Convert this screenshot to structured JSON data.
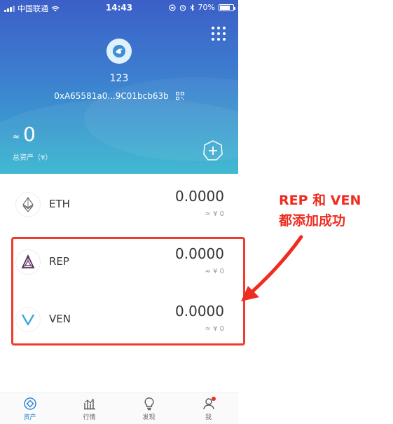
{
  "status_bar": {
    "carrier": "中国联通",
    "time": "14:43",
    "battery": "70%"
  },
  "header": {
    "wallet_name": "123",
    "address": "0xA65581a0...9C01bcb63b",
    "approx_symbol": "≈",
    "total_value": "0",
    "total_label": "总资产（¥）"
  },
  "assets": [
    {
      "symbol": "ETH",
      "balance": "0.0000",
      "fiat": "≈ ¥ 0",
      "icon": "eth-icon"
    },
    {
      "symbol": "REP",
      "balance": "0.0000",
      "fiat": "≈ ¥ 0",
      "icon": "rep-icon"
    },
    {
      "symbol": "VEN",
      "balance": "0.0000",
      "fiat": "≈ ¥ 0",
      "icon": "ven-icon"
    }
  ],
  "annotation": {
    "line1": "REP 和 VEN",
    "line2": "都添加成功",
    "color": "#ef2c1f"
  },
  "tabs": [
    {
      "label": "资产",
      "icon": "asset-icon",
      "active": true
    },
    {
      "label": "行情",
      "icon": "market-icon",
      "active": false
    },
    {
      "label": "发现",
      "icon": "discover-icon",
      "active": false
    },
    {
      "label": "我",
      "icon": "profile-icon",
      "active": false
    }
  ],
  "colors": {
    "accent": "#2f86d6",
    "highlight": "#ef3b2c"
  }
}
